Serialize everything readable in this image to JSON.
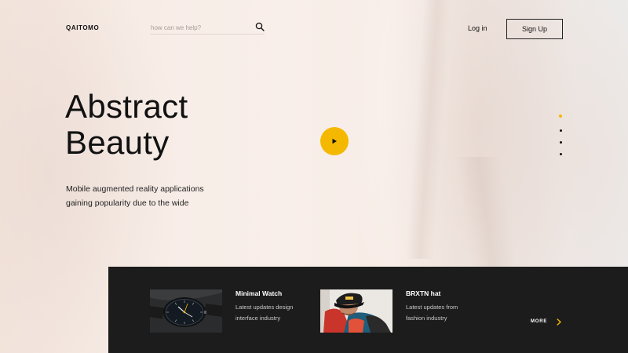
{
  "brand": {
    "logo": "QAITOMO"
  },
  "search": {
    "placeholder": "how can we help?",
    "value": ""
  },
  "nav": {
    "login_label": "Log in",
    "signup_label": "Sign Up"
  },
  "hero": {
    "title_lines": [
      "Abstract",
      "Beauty"
    ],
    "description_lines": [
      "Mobile augmented reality applications",
      "gaining popularity due to the wide"
    ]
  },
  "video": {
    "icon": "play-icon"
  },
  "pagination": {
    "count": 4,
    "active_index": 0
  },
  "products": [
    {
      "title": "Minimal Watch",
      "description_lines": [
        "Latest updates design",
        "interface industry"
      ],
      "image": "watch-image"
    },
    {
      "title": "BRXTN hat",
      "description_lines": [
        "Latest updates from",
        "fashion industry"
      ],
      "image": "hat-image"
    }
  ],
  "more": {
    "label": "MORE",
    "icon": "chevron-right-icon"
  },
  "colors": {
    "accent": "#f5b800",
    "panel": "#1c1c1c",
    "background": "#f6ebe5",
    "text": "#111111"
  }
}
